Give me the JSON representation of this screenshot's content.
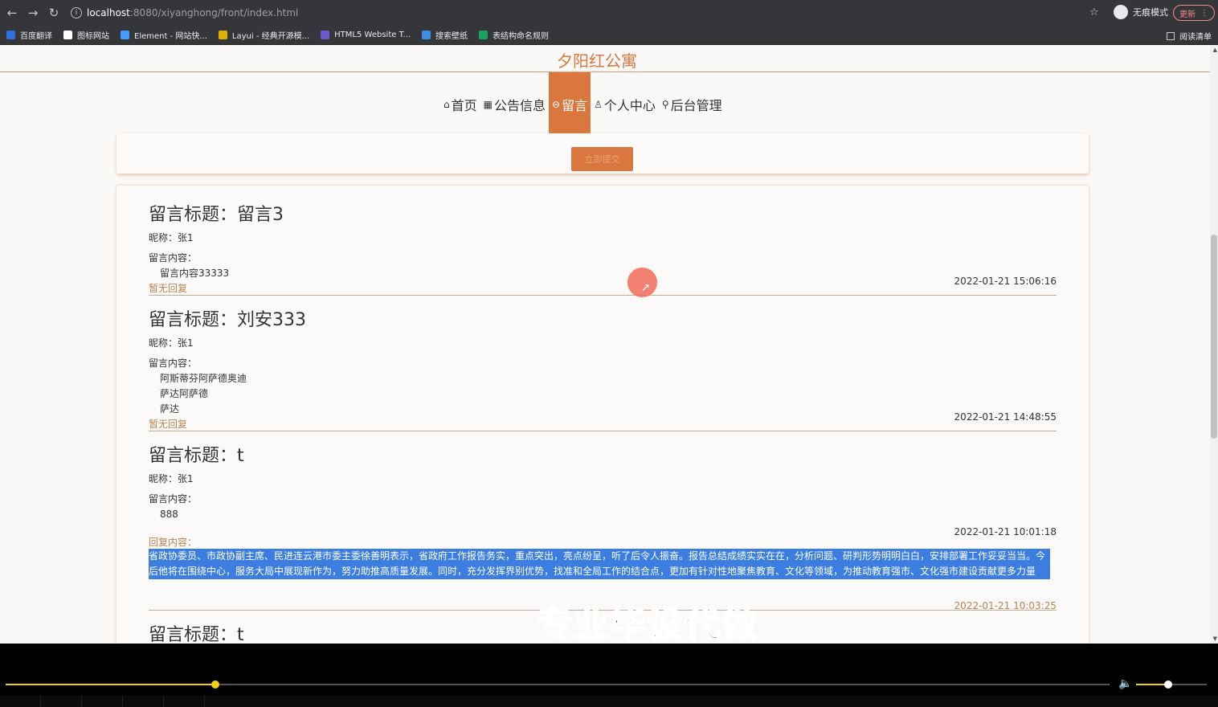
{
  "browser": {
    "url_host": "localhost",
    "url_path": ":8080/xiyanghong/front/index.html",
    "incognito_label": "无痕模式",
    "update_label": "更新",
    "bookmarks": [
      {
        "label": "百度翻译",
        "color": "#2f6fe0"
      },
      {
        "label": "图标网站",
        "color": "#ffffff"
      },
      {
        "label": "Element - 网站快...",
        "color": "#409eff"
      },
      {
        "label": "Layui - 经典开源模...",
        "color": "#e0b000"
      },
      {
        "label": "HTML5 Website T...",
        "color": "#6a5acd"
      },
      {
        "label": "搜索壁纸",
        "color": "#3a8ee6"
      },
      {
        "label": "表结构命名规则",
        "color": "#1aa260"
      }
    ],
    "reading_list": "阅读清单"
  },
  "site": {
    "title": "夕阳红公寓",
    "accent": "#d9773e",
    "menu": [
      {
        "icon": "⌂",
        "label": "首页"
      },
      {
        "icon": "▦",
        "label": "公告信息"
      },
      {
        "icon": "⊖",
        "label": "留言"
      },
      {
        "icon": "♙",
        "label": "个人中心"
      },
      {
        "icon": "⚲",
        "label": "后台管理"
      }
    ],
    "submit_label": "立即提交"
  },
  "messages": [
    {
      "title": "留言标题：留言3",
      "nickname": "昵称：张1",
      "content_label": "留言内容：",
      "content_lines": [
        "留言内容33333"
      ],
      "reply_status": "暂无回复",
      "date": "2022-01-21 15:06:16"
    },
    {
      "title": "留言标题：刘安333",
      "nickname": "昵称：张1",
      "content_label": "留言内容：",
      "content_lines": [
        "阿斯蒂芬阿萨德奥迪",
        "萨达阿萨德",
        "萨达"
      ],
      "reply_status": "暂无回复",
      "date": "2022-01-21 14:48:55"
    },
    {
      "title": "留言标题：t",
      "nickname": "昵称：张1",
      "content_label": "留言内容：",
      "content_lines": [
        "888"
      ],
      "date": "2022-01-21 10:01:18",
      "reply_label": "回复内容：",
      "reply_text": "省政协委员、市政协副主席、民进连云港市委主委徐善明表示，省政府工作报告务实，重点突出，亮点纷呈，听了后令人振奋。报告总结成绩实实在在，分析问题、研判形势明明白白，安排部署工作妥妥当当。今后他将在围绕中心，服务大局中展现新作为，努力助推高质量发展。同时，充分发挥界别优势，找准和全局工作的结合点，更加有针对性地聚焦教育、文化等领域，为推动教育强市、文化强市建设贡献更多力量",
      "reply_date": "2022-01-21 10:03:25"
    },
    {
      "title": "留言标题：t"
    }
  ],
  "watermark": "专业毕设代做",
  "player": {
    "progress": 0.19,
    "volume": 0.45,
    "accent": "#f2d00e"
  }
}
